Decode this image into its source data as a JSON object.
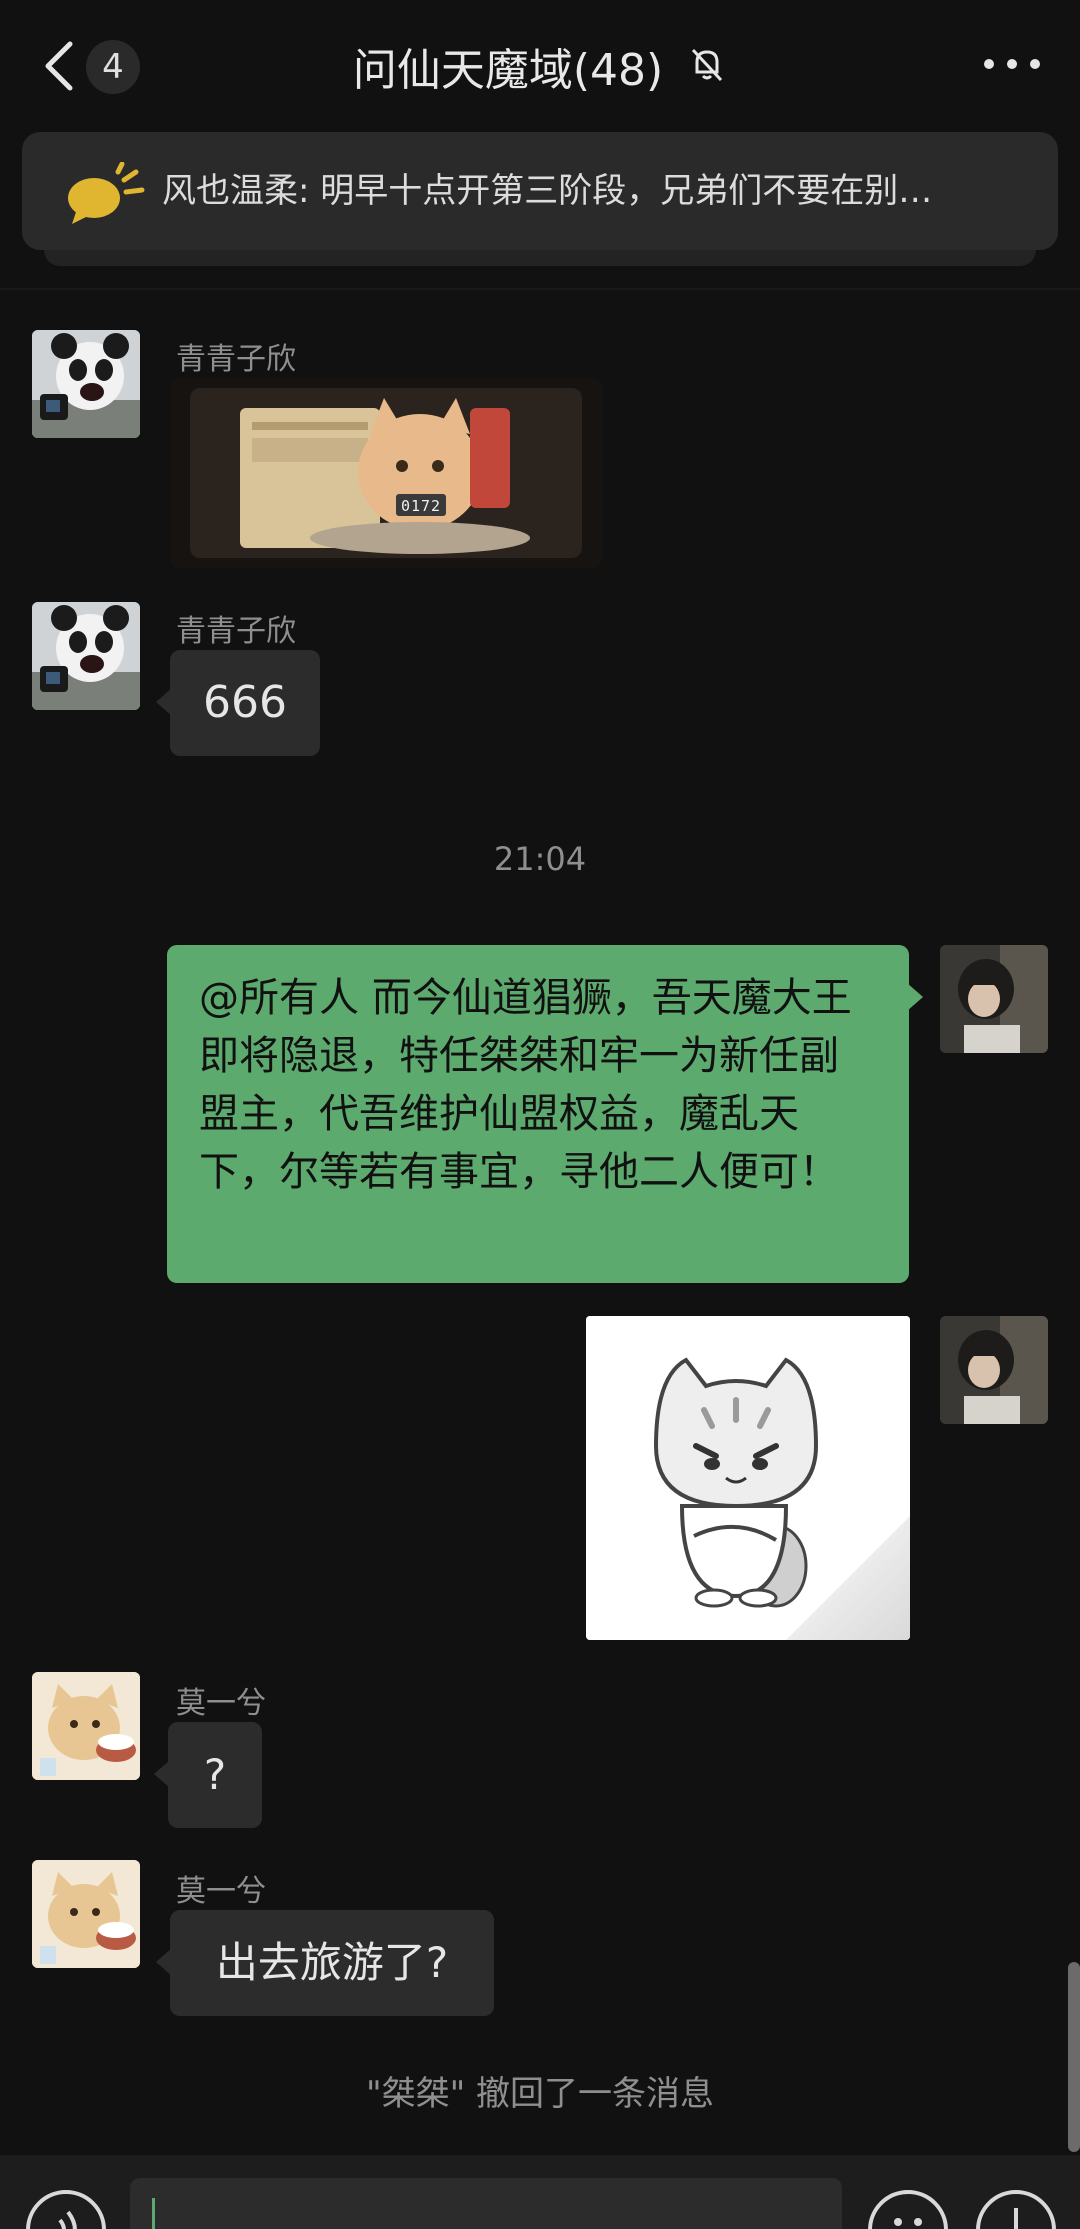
{
  "header": {
    "unread_count": "4",
    "title": "问仙天魔域(48)"
  },
  "pinned": {
    "text": "风也温柔: 明早十点开第三阶段，兄弟们不要在别…"
  },
  "messages": [
    {
      "sender": "青青子欣",
      "type": "image",
      "image": {
        "counter": "0172"
      }
    },
    {
      "sender": "青青子欣",
      "type": "text",
      "text": "666"
    },
    {
      "type": "time",
      "text": "21:04"
    },
    {
      "type": "text_out",
      "text": "@所有人  而今仙道猖獗，吾天魔大王即将隐退，特任桀桀和牢一为新任副盟主，代吾维护仙盟权益，魔乱天下，尔等若有事宜，寻他二人便可！"
    },
    {
      "type": "sticker_out"
    },
    {
      "sender": "莫一兮",
      "type": "text",
      "text": "?"
    },
    {
      "sender": "莫一兮",
      "type": "text",
      "text": "出去旅游了?"
    },
    {
      "type": "system",
      "text": "\"桀桀\" 撤回了一条消息"
    }
  ],
  "colors": {
    "background": "#111111",
    "bubble_incoming": "#2c2c2c",
    "bubble_outgoing": "#5daa6f",
    "muted_text": "#8f8f8f"
  }
}
